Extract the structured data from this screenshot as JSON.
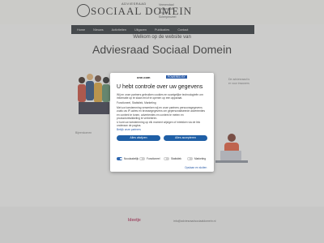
{
  "header": {
    "logo_text": "SOCIAAL DOMEIN",
    "logo_sub": "ADVIESRAAD",
    "side_lines": [
      "Veenendaal",
      "Renswoude",
      "Rhenen",
      "Scherpenzeel"
    ]
  },
  "nav": {
    "items": [
      "Home",
      "Nieuws",
      "Activiteiten",
      "Uitgaven",
      "Publicaties",
      "Contact"
    ]
  },
  "hero": {
    "welcome": "Welkom op de website van",
    "title": "Adviesraad Sociaal Domein"
  },
  "background_text": {
    "left_heading": "Bijeenkomen",
    "right_lines": [
      "De adviesraad is",
      "er voor inwoners"
    ]
  },
  "cookie_modal": {
    "brand": "one.com",
    "brand_badge": "POWERED BY",
    "title": "U hebt controle over uw gegevens",
    "intro": "Wij en onze partners gebruiken cookies en soortgelijke technologieën om informatie op te slaan en/of te openen op een apparaat.",
    "purposes": "Functioneel, Statistiek, Marketing",
    "body1": "Met uw toestemming verwerken wij en onze partners persoonsgegevens zoals uw IP-adres en browsegegevens om gepersonaliseerde advertenties en content te tonen, advertenties en content te meten en productontwikkeling te verbeteren.",
    "body2": "U kunt uw toestemming op elk moment wijzigen of intrekken via de link onderaan de pagina.",
    "link": "Bekijk onze partners",
    "reject_label": "Alles afwijzen",
    "accept_label": "Alles accepteren",
    "checks": [
      {
        "label": "Noodzakelijk",
        "on": true
      },
      {
        "label": "Functioneel",
        "on": false
      },
      {
        "label": "Statistiek",
        "on": false
      },
      {
        "label": "Marketing",
        "on": false
      }
    ],
    "save_link": "Opslaan en sluiten"
  },
  "footer": {
    "brand": "Ideetje",
    "contact": "info@adviesraadsociaaldomein.nl"
  },
  "colors": {
    "accent": "#1f5fa6",
    "nav_bg": "#2f3438"
  }
}
